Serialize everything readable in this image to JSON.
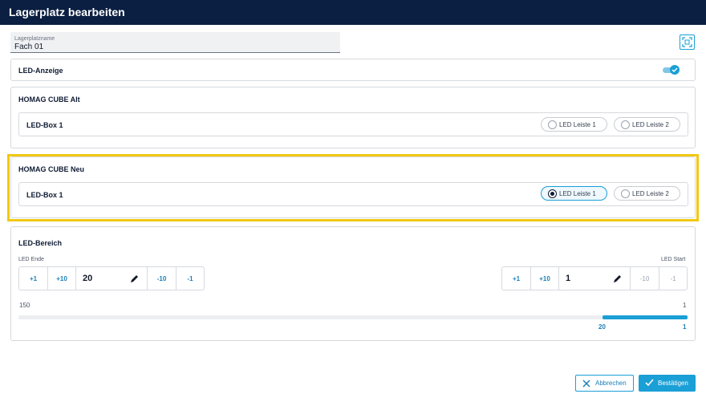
{
  "window": {
    "title": "Lagerplatz bearbeiten"
  },
  "storage_field": {
    "label": "Lagerplatzname",
    "value": "Fach 01"
  },
  "led_display": {
    "label": "LED-Anzeige",
    "enabled": true
  },
  "homag_alt": {
    "title": "HOMAG CUBE Alt",
    "box_label": "LED-Box 1",
    "options": [
      {
        "label": "LED Leiste 1",
        "selected": false
      },
      {
        "label": "LED Leiste 2",
        "selected": false
      }
    ]
  },
  "homag_neu": {
    "title": "HOMAG CUBE Neu",
    "box_label": "LED-Box 1",
    "options": [
      {
        "label": "LED Leiste 1",
        "selected": true
      },
      {
        "label": "LED Leiste 2",
        "selected": false
      }
    ]
  },
  "led_range": {
    "title": "LED-Bereich",
    "end": {
      "label": "LED Ende",
      "value": "20",
      "plus1": "+1",
      "plus10": "+10",
      "minus10": "-10",
      "minus1": "-1"
    },
    "start": {
      "label": "LED Start",
      "value": "1",
      "plus1": "+1",
      "plus10": "+10",
      "minus10": "-10",
      "minus1": "-1"
    },
    "scale_left": "150",
    "scale_right": "1",
    "range_end_label": "20",
    "range_start_label": "1"
  },
  "footer": {
    "cancel_label": "Abbrechen",
    "confirm_label": "Bestätigen"
  },
  "colors": {
    "header": "#0b1f42",
    "accent": "#1a9fd6",
    "highlight": "#f2c811"
  }
}
